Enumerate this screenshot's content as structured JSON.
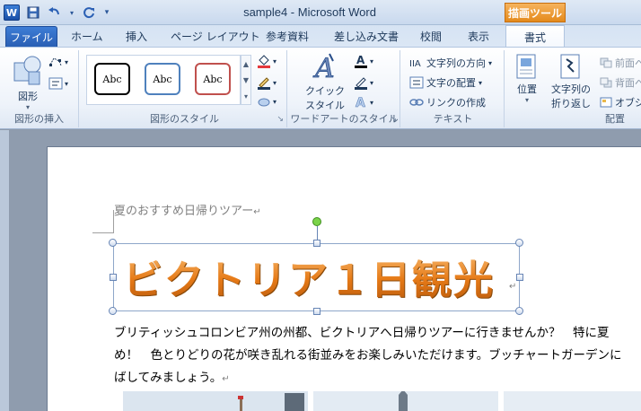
{
  "window": {
    "title": "sample4 - Microsoft Word",
    "app_icon_letter": "W"
  },
  "tabs": {
    "file": "ファイル",
    "items": [
      "ホーム",
      "挿入",
      "ページ レイアウト",
      "参考資料",
      "差し込み文書",
      "校閲",
      "表示"
    ],
    "context_header": "描画ツール",
    "context_tab": "書式"
  },
  "ribbon": {
    "insert_shapes": {
      "shape_label": "図形",
      "group_label": "図形の挿入"
    },
    "shape_styles": {
      "style_sample": "Abc",
      "group_label": "図形のスタイル"
    },
    "wordart_styles": {
      "quick_styles_line1": "クイック",
      "quick_styles_line2": "スタイル",
      "group_label": "ワードアートのスタイル"
    },
    "text": {
      "text_direction": "文字列の方向",
      "align_text": "文字の配置",
      "create_link": "リンクの作成",
      "group_label": "テキスト"
    },
    "arrange": {
      "position": "位置",
      "wrap_line1": "文字列の",
      "wrap_line2": "折り返し",
      "bring_forward": "前面へ",
      "send_backward": "背面へ",
      "selection_pane": "オブジ",
      "group_label": "配置"
    }
  },
  "document": {
    "heading": "夏のおすすめ日帰りツアー",
    "wordart": "ビクトリア１日観光",
    "paragraph_lines": [
      "ブリティッシュコロンビア州の州都、ビクトリアへ日帰りツアーに行きませんか？　特に夏",
      "め！　色とりどりの花が咲き乱れる街並みをお楽しみいただけます。ブッチャートガーデンに",
      "ばしてみましょう。"
    ],
    "paragraph_mark": "↵"
  },
  "colors": {
    "style1_border": "#000000",
    "style2_border": "#4f81bd",
    "style3_border": "#c0504d",
    "wordart_fill": "#e98a2a",
    "context_header": "#e48a1c"
  }
}
